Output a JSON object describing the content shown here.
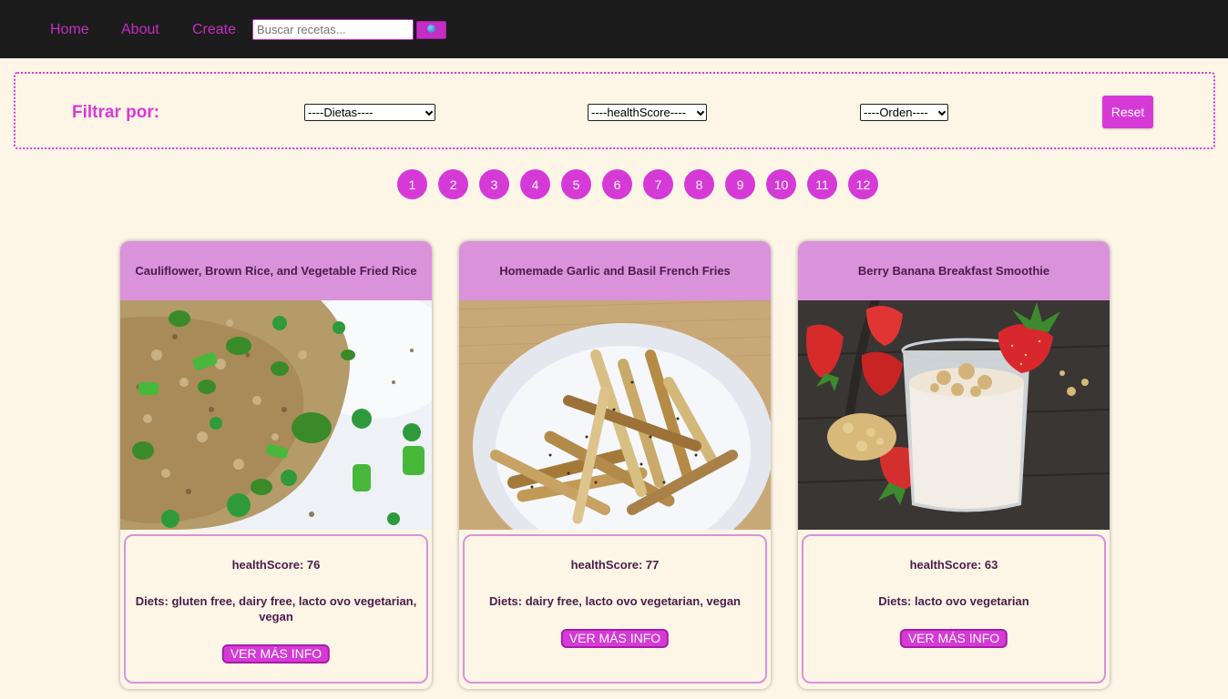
{
  "nav": {
    "links": [
      "Home",
      "About",
      "Create"
    ],
    "search_placeholder": "Buscar recetas...",
    "accent_color": "#c32ec3"
  },
  "filters": {
    "label": "Filtrar por:",
    "diet_select": "----Dietas----",
    "health_select": "----healthScore----",
    "order_select": "----Orden----",
    "reset_label": "Reset"
  },
  "pagination": {
    "pages": [
      "1",
      "2",
      "3",
      "4",
      "5",
      "6",
      "7",
      "8",
      "9",
      "10",
      "11",
      "12"
    ]
  },
  "recipes": [
    {
      "title": "Cauliflower, Brown Rice, and Vegetable Fried Rice",
      "health_score": "healthScore: 76",
      "diets": "Diets: gluten free, dairy free, lacto ovo vegetarian, vegan",
      "button_label": "VER MÁS INFO",
      "image_icon": "fried-rice-photo"
    },
    {
      "title": "Homemade Garlic and Basil French Fries",
      "health_score": "healthScore: 77",
      "diets": "Diets: dairy free, lacto ovo vegetarian, vegan",
      "button_label": "VER MÁS INFO",
      "image_icon": "french-fries-photo"
    },
    {
      "title": "Berry Banana Breakfast Smoothie",
      "health_score": "healthScore: 63",
      "diets": "Diets: lacto ovo vegetarian",
      "button_label": "VER MÁS INFO",
      "image_icon": "smoothie-photo"
    }
  ],
  "colors": {
    "background": "#fdf5e6",
    "navbar": "#1c1c1c",
    "primary": "#d63ad6",
    "card_header": "#da92da",
    "text_dark": "#4a1d4a"
  }
}
